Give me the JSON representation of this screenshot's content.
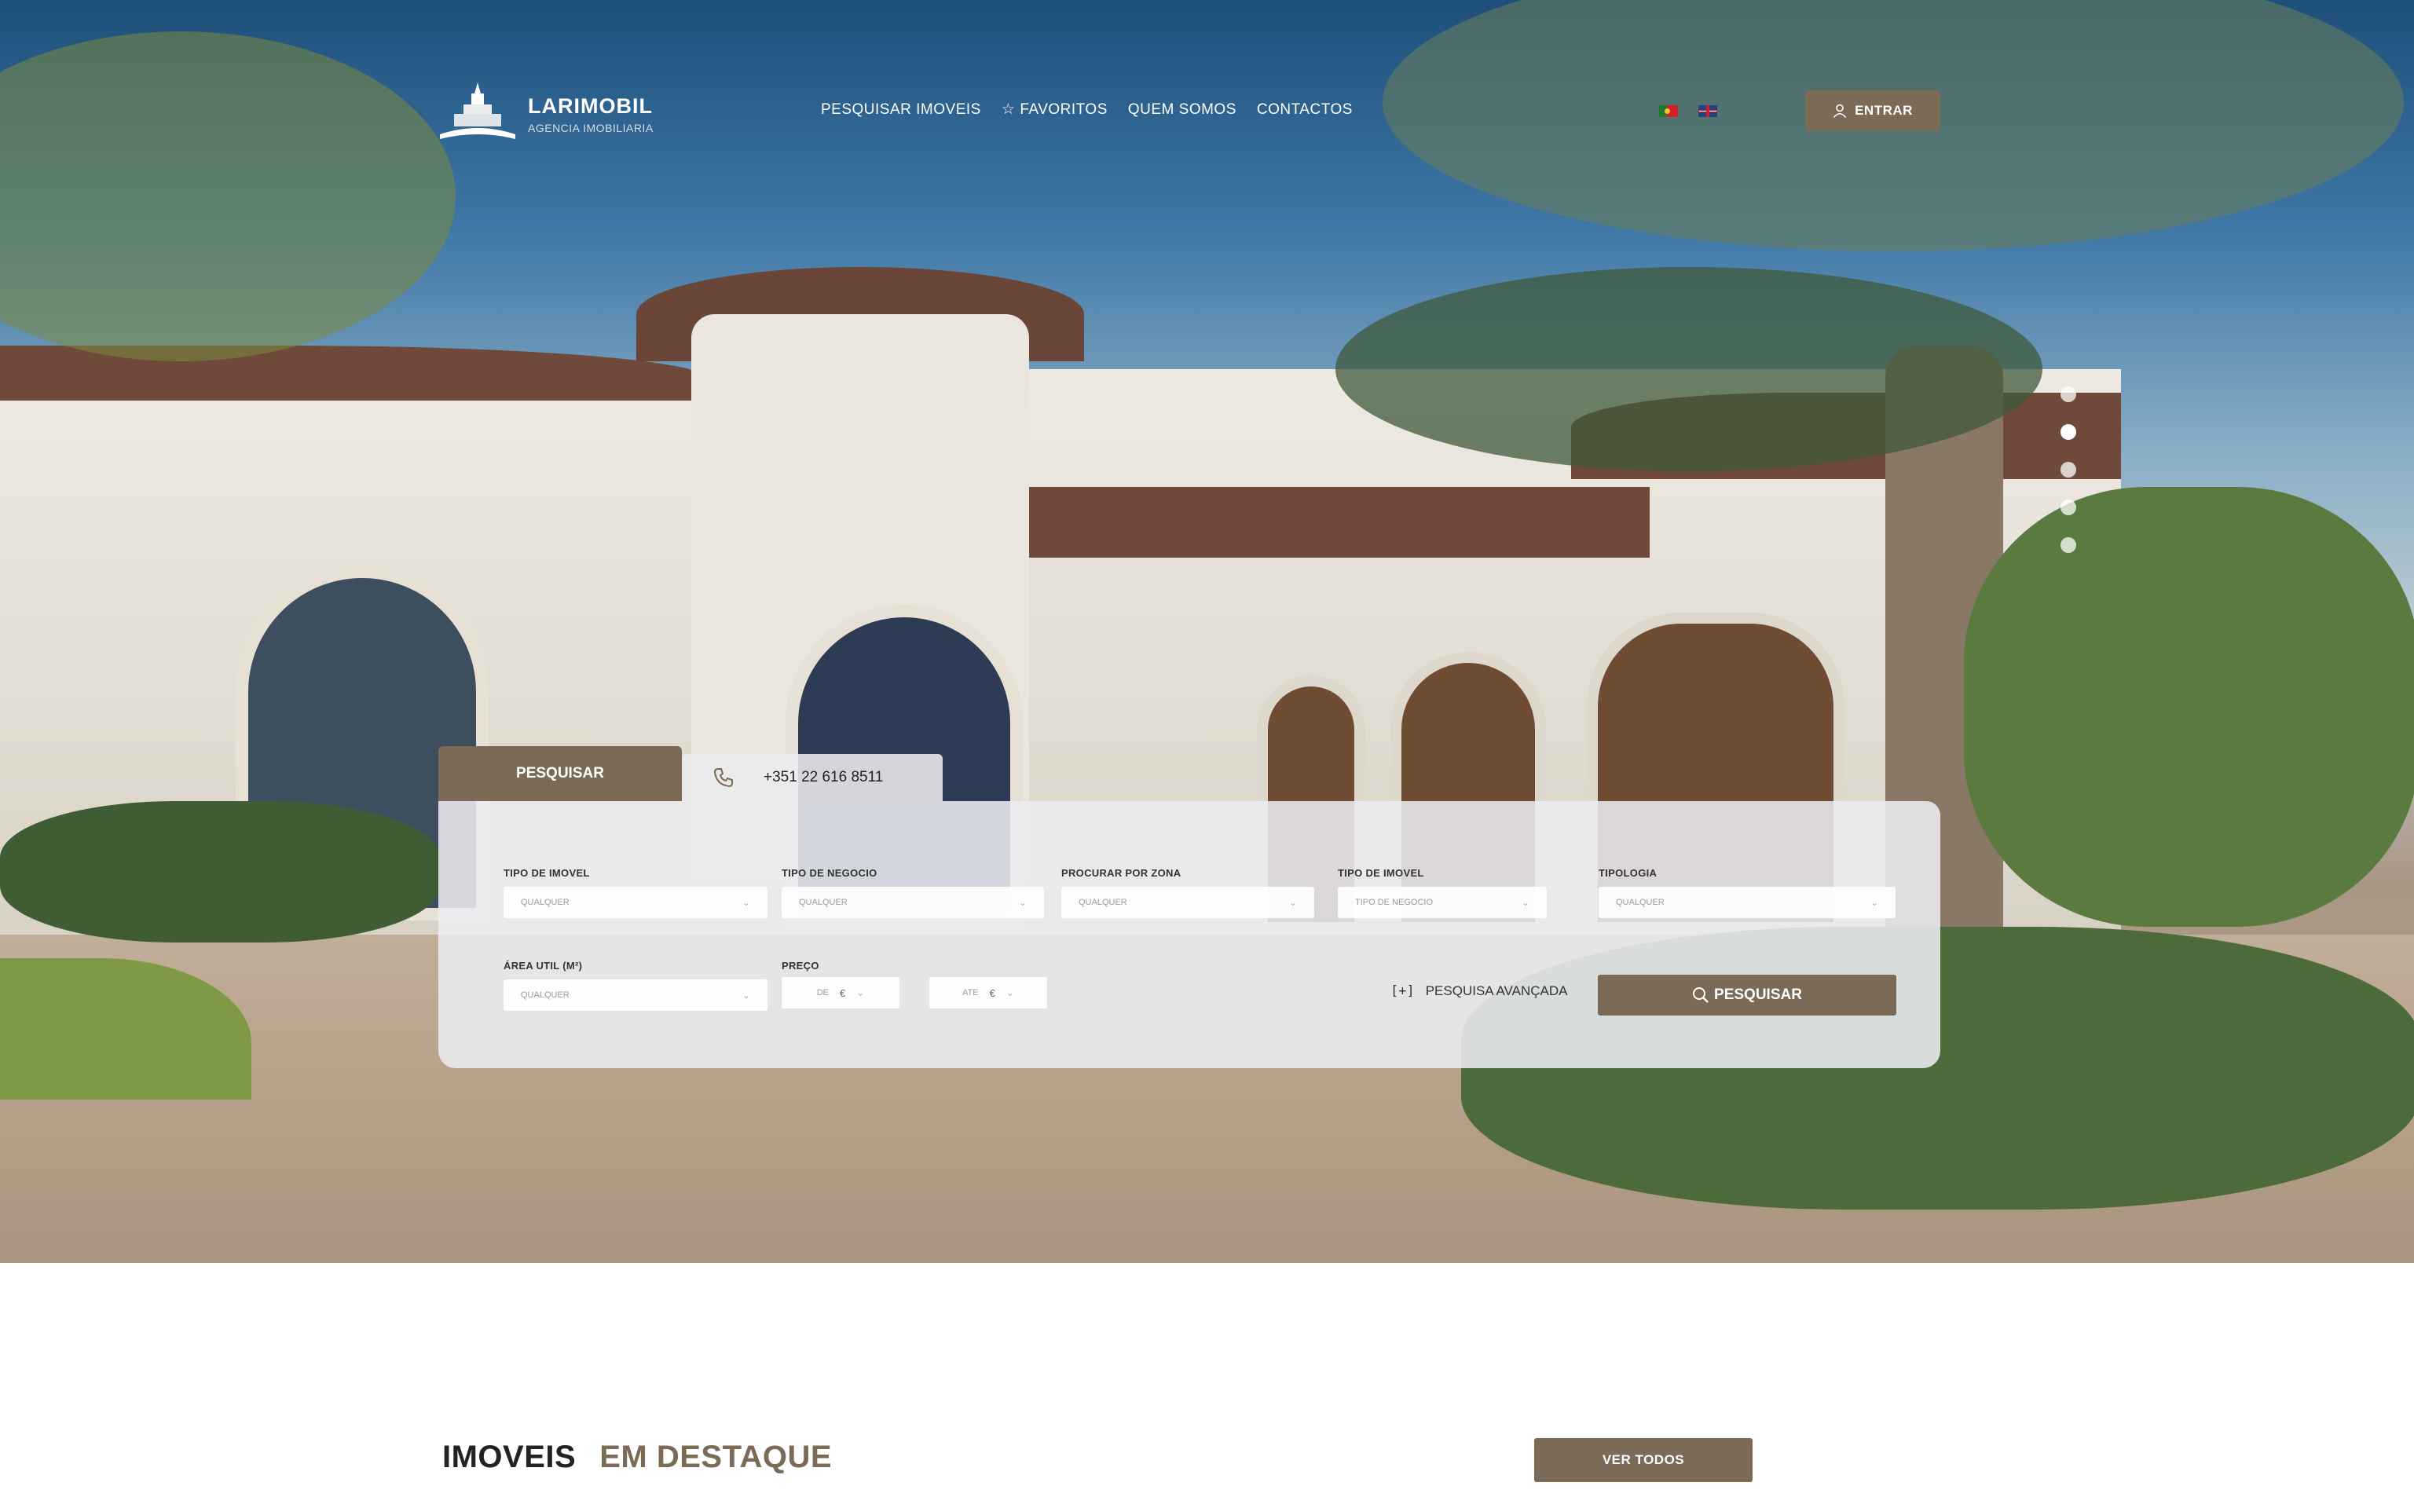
{
  "brand": {
    "name": "LARIMOBIL",
    "tagline": "AGENCIA IMOBILIARIA"
  },
  "nav": {
    "items": [
      {
        "label": "PESQUISAR IMOVEIS",
        "icon": ""
      },
      {
        "label": "FAVORITOS",
        "icon": "star-icon"
      },
      {
        "label": "QUEM SOMOS",
        "icon": ""
      },
      {
        "label": "CONTACTOS",
        "icon": ""
      }
    ],
    "languages": [
      "flag-pt-icon",
      "flag-uk-icon"
    ],
    "login_label": "ENTRAR"
  },
  "hero": {
    "slider_dots": 5,
    "active_dot": 2
  },
  "search": {
    "tab_search": "PESQUISAR",
    "phone": "+351 22 616 8511",
    "fields": {
      "tipo_imovel_1": {
        "label": "TIPO DE IMOVEL",
        "value": "QUALQUER"
      },
      "tipo_negocio": {
        "label": "TIPO DE NEGOCIO",
        "value": "QUALQUER"
      },
      "zona": {
        "label": "PROCURAR POR ZONA",
        "value": "QUALQUER"
      },
      "tipo_imovel_2": {
        "label": "TIPO DE IMOVEL",
        "value": "TIPO DE NEGOCIO"
      },
      "tipologia": {
        "label": "TIPOLOGIA",
        "value": "QUALQUER"
      },
      "area": {
        "label": "ÁREA UTIL (M²)",
        "value": "QUALQUER"
      },
      "preco": {
        "label": "PREÇO",
        "de": "DE",
        "ate": "ATE",
        "currency": "€"
      }
    },
    "advanced_bracket": "[+]",
    "advanced_label": "PESQUISA AVANÇADA",
    "submit_label": "PESQUISAR"
  },
  "featured": {
    "title_a": "IMOVEIS",
    "title_b": "EM DESTAQUE",
    "view_all": "VER TODOS"
  },
  "colors": {
    "accent": "#7a6a56"
  }
}
